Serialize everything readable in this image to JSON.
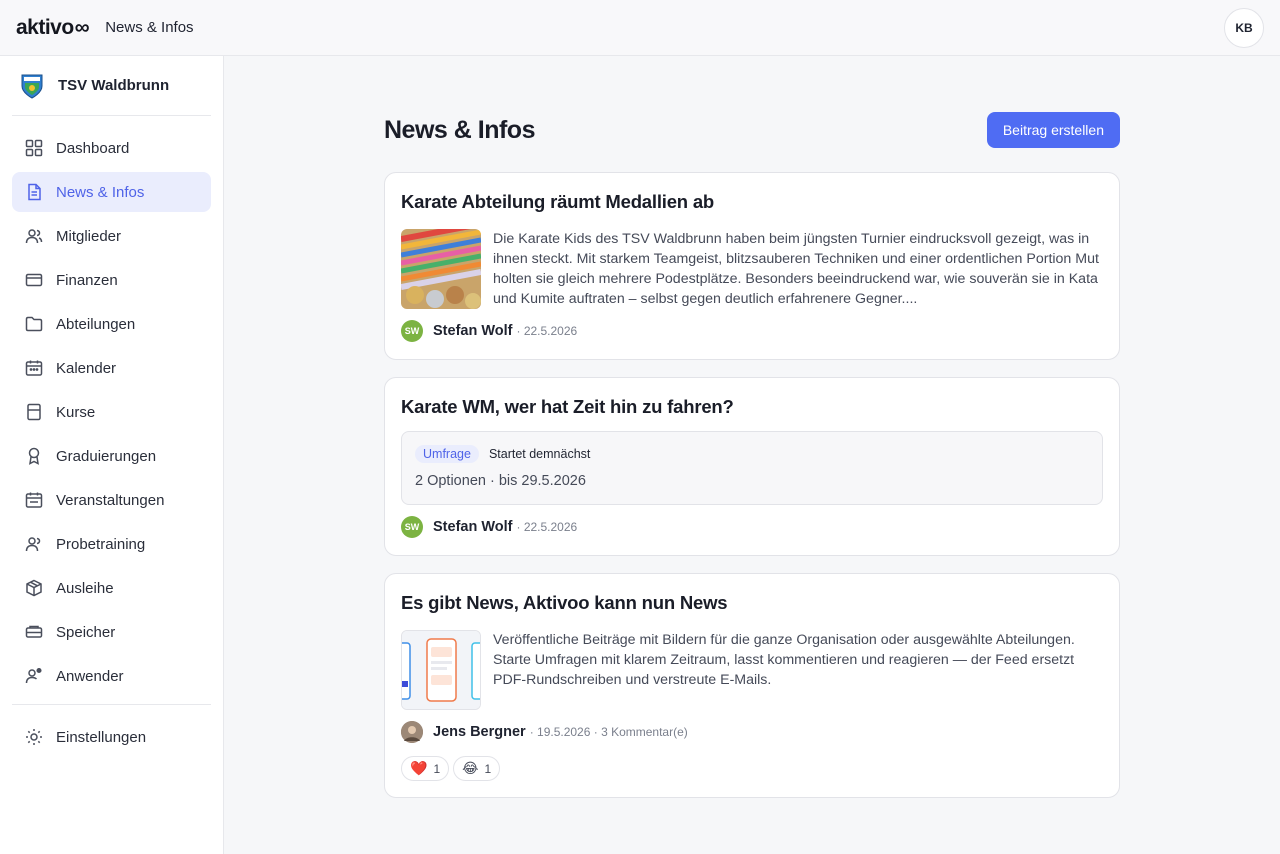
{
  "topbar": {
    "brand": "aktivo",
    "brand_suffix": "∞",
    "page_label": "News & Infos",
    "user_initials": "KB"
  },
  "sidebar": {
    "org_name": "TSV Waldbrunn",
    "items": [
      {
        "label": "Dashboard",
        "icon": "grid-icon"
      },
      {
        "label": "News & Infos",
        "icon": "document-icon",
        "active": true
      },
      {
        "label": "Mitglieder",
        "icon": "users-icon"
      },
      {
        "label": "Finanzen",
        "icon": "wallet-icon"
      },
      {
        "label": "Abteilungen",
        "icon": "folder-icon"
      },
      {
        "label": "Kalender",
        "icon": "calendar-icon"
      },
      {
        "label": "Kurse",
        "icon": "book-icon"
      },
      {
        "label": "Graduierungen",
        "icon": "award-icon"
      },
      {
        "label": "Veranstaltungen",
        "icon": "calendar-event-icon"
      },
      {
        "label": "Probetraining",
        "icon": "users-icon"
      },
      {
        "label": "Ausleihe",
        "icon": "package-icon"
      },
      {
        "label": "Speicher",
        "icon": "storage-icon"
      },
      {
        "label": "Anwender",
        "icon": "user-cog-icon"
      }
    ],
    "settings_label": "Einstellungen"
  },
  "main": {
    "title": "News & Infos",
    "create_button": "Beitrag erstellen",
    "posts": [
      {
        "title": "Karate Abteilung räumt Medallien ab",
        "excerpt": "Die Karate Kids des TSV Waldbrunn haben beim jüngsten Turnier eindrucksvoll gezeigt, was in ihnen steckt. Mit starkem Teamgeist, blitzsauberen Techniken und einer ordentlichen Portion Mut holten sie gleich mehrere Podestplätze. Besonders beeindruckend war, wie souverän sie in Kata und Kumite auftraten – selbst gegen deutlich erfahrenere Gegner....",
        "author_initials": "SW",
        "author": "Stefan Wolf",
        "meta": "· 22.5.2026"
      },
      {
        "title": "Karate WM, wer hat Zeit hin zu fahren?",
        "poll_badge": "Umfrage",
        "poll_status": "Startet demnächst",
        "poll_info": "2 Optionen · bis 29.5.2026",
        "author_initials": "SW",
        "author": "Stefan Wolf",
        "meta": "· 22.5.2026"
      },
      {
        "title": "Es gibt News, Aktivoo kann nun News",
        "excerpt": "Veröffentliche Beiträge mit Bildern für die ganze Organisation oder ausgewählte Abteilungen. Starte Umfragen mit klarem Zeitraum, lasst kommentieren und reagieren — der Feed ersetzt PDF-Rundschreiben und verstreute E-Mails.",
        "author": "Jens Bergner",
        "meta": "· 19.5.2026 · 3 Kommentar(e)",
        "reactions": [
          {
            "emoji": "❤️",
            "count": "1"
          },
          {
            "emoji": "😂",
            "count": "1"
          }
        ]
      }
    ]
  },
  "colors": {
    "accent": "#4f6cf3",
    "active_bg": "#eaedfd",
    "author_green": "#7cb342"
  }
}
